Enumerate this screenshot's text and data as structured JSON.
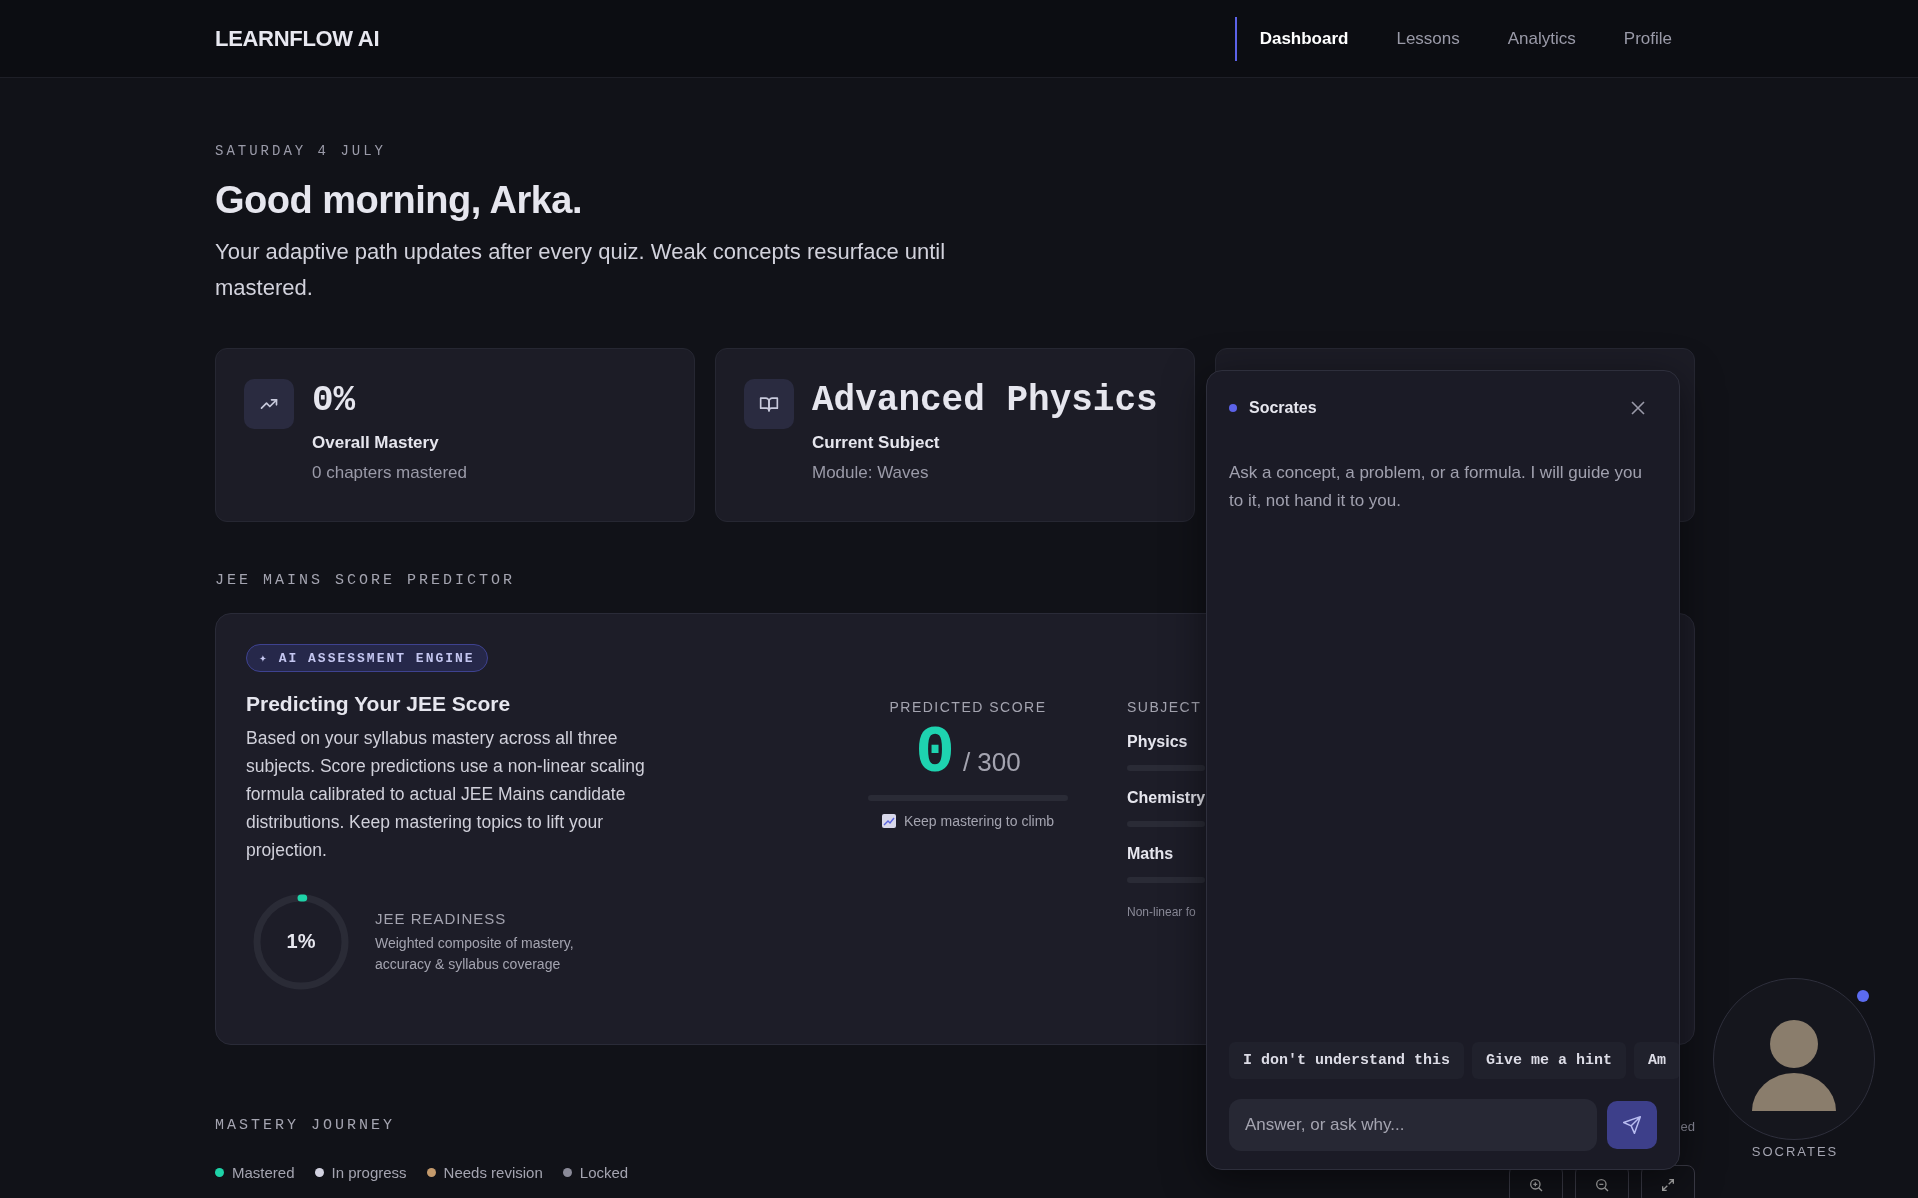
{
  "brand": "LEARNFLOW AI",
  "nav": [
    {
      "label": "Dashboard",
      "selected": true
    },
    {
      "label": "Lessons",
      "selected": false
    },
    {
      "label": "Analytics",
      "selected": false
    },
    {
      "label": "Profile",
      "selected": false
    }
  ],
  "date": "SATURDAY 4 JULY",
  "greeting": "Good morning, Arka.",
  "subtitle": "Your adaptive path updates after every quiz. Weak concepts resurface until mastered.",
  "stats": [
    {
      "kind": "trend",
      "value": "0%",
      "label": "Overall Mastery",
      "detail": "0 chapters mastered"
    },
    {
      "kind": "book",
      "value": "Advanced Physics",
      "label": "Current Subject",
      "detail": "Module: Waves"
    },
    {
      "kind": "hidden"
    }
  ],
  "predictor": {
    "section": "JEE MAINS SCORE PREDICTOR",
    "badge": "✦ AI ASSESSMENT ENGINE",
    "title": "Predicting Your JEE Score",
    "description": "Based on your syllabus mastery across all three subjects. Score predictions use a non-linear scaling formula calibrated to actual JEE Mains candidate distributions. Keep mastering topics to lift your projection.",
    "readiness": {
      "level": 0.01,
      "value": "1%",
      "label": "JEE READINESS",
      "detail": "Weighted composite of mastery, accuracy & syllabus coverage"
    },
    "score": {
      "label": "PREDICTED SCORE",
      "value": "0",
      "max": "/ 300",
      "level": 0,
      "hint": "Keep mastering to climb"
    },
    "subjects_heading": "SUBJECT",
    "subjects": [
      {
        "name": "Physics",
        "level": 0
      },
      {
        "name": "Chemistry",
        "level": 0
      },
      {
        "name": "Maths",
        "level": 0
      }
    ],
    "footnote": "Non-linear fo"
  },
  "journey": {
    "section": "MASTERY JOURNEY",
    "status": "ed",
    "legend": [
      {
        "label": "Mastered",
        "color": "#1ed3a8"
      },
      {
        "label": "In progress",
        "color": "#d2d2e0"
      },
      {
        "label": "Needs revision",
        "color": "#c49a6c"
      },
      {
        "label": "Locked",
        "color": "#8a8a98"
      }
    ]
  },
  "chat": {
    "title": "Socrates",
    "intro": "Ask a concept, a problem, or a formula. I will guide you to it, not hand it to you.",
    "chips": [
      "I don't understand this",
      "Give me a hint",
      "Am"
    ],
    "placeholder": "Answer, or ask why..."
  },
  "tutor": {
    "name": "SOCRATES",
    "online": true
  }
}
